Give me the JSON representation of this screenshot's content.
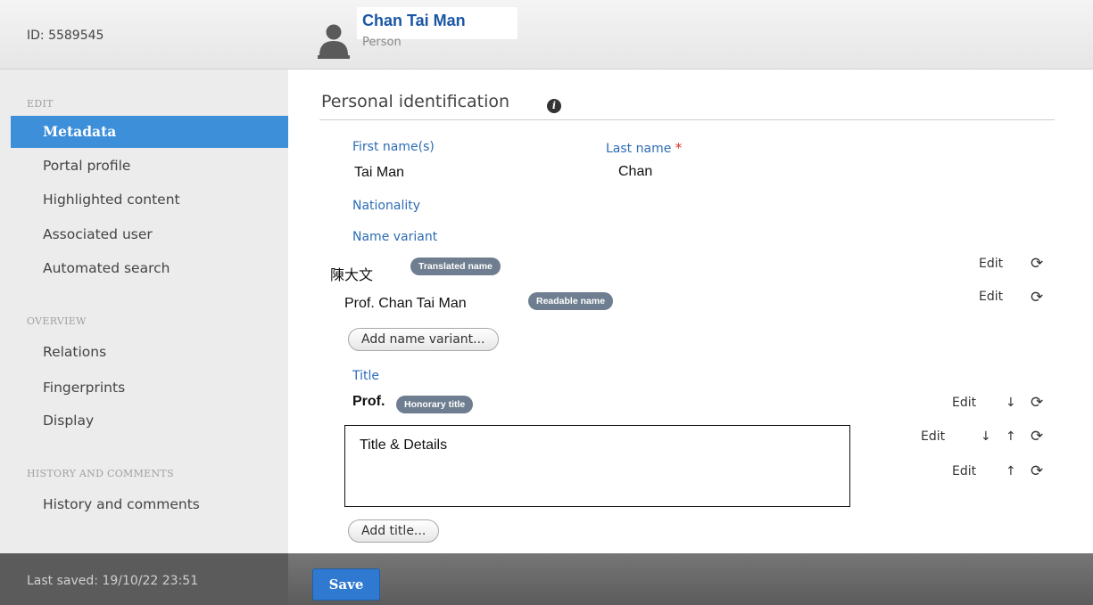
{
  "header": {
    "id_label": "ID: 5589545",
    "name": "Chan Tai Man",
    "type": "Person"
  },
  "sidebar": {
    "edit_section": "EDIT",
    "edit_items": [
      "Metadata",
      "Portal profile",
      "Highlighted content",
      "Associated user",
      "Automated search"
    ],
    "active_item": "Metadata",
    "overview_section": "OVERVIEW",
    "overview_items": [
      "Relations",
      "Fingerprints",
      "Display"
    ],
    "history_section": "HISTORY AND COMMENTS",
    "history_items": [
      "History and comments"
    ]
  },
  "main": {
    "section_title": "Personal identification",
    "info_icon": "i",
    "first_name_label": "First name(s)",
    "first_name_value": "Tai Man",
    "last_name_label": "Last name",
    "required_mark": "*",
    "last_name_value": "Chan",
    "nationality_label": "Nationality",
    "name_variant_label": "Name variant",
    "variants": [
      {
        "value": "陳大文",
        "badge": "Translated name",
        "edit": "Edit"
      },
      {
        "value": "Prof. Chan Tai Man",
        "badge": "Readable name",
        "edit": "Edit"
      }
    ],
    "add_variant_button": "Add name variant...",
    "title_label": "Title",
    "title_value": "Prof.",
    "title_badge": "Honorary title",
    "title_rows_edit": [
      "Edit",
      "Edit",
      "Edit"
    ],
    "textbox_text": "Title & Details",
    "add_title_button": "Add title...",
    "icons": {
      "down": "↓",
      "up": "↑",
      "refresh": "⟳"
    }
  },
  "footer": {
    "last_saved": "Last saved: 19/10/22 23:51",
    "save_button": "Save"
  }
}
